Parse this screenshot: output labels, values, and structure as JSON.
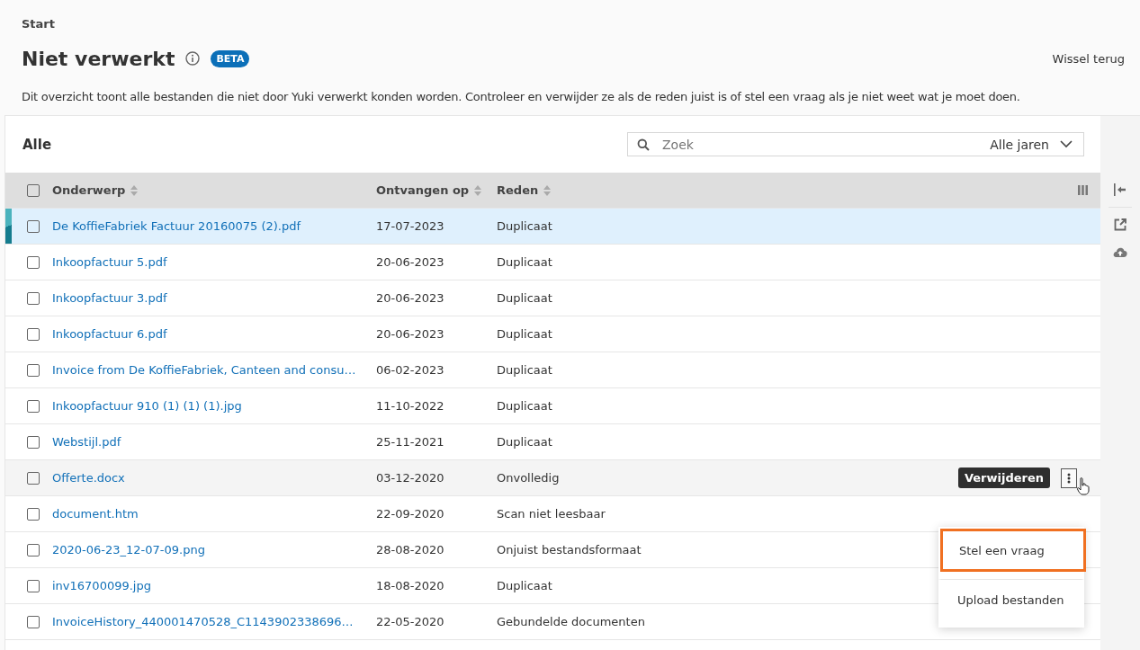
{
  "breadcrumb": "Start",
  "title": "Niet verwerkt",
  "badge": "BETA",
  "switch_back": "Wissel terug",
  "description": "Dit overzicht toont alle bestanden die niet door Yuki verwerkt konden worden. Controleer en verwijder ze als de reden juist is of stel een vraag als je niet weet wat je moet doen.",
  "panel": {
    "title": "Alle",
    "search": {
      "placeholder": "Zoek"
    },
    "year_filter": "Alle jaren"
  },
  "table": {
    "select_all_checked": false,
    "columns": [
      "Onderwerp",
      "Ontvangen op",
      "Reden"
    ],
    "rows": [
      {
        "subject": "De KoffieFabriek Factuur 20160075 (2).pdf",
        "received": "17-07-2023",
        "reason": "Duplicaat",
        "selected": true,
        "hovered": false,
        "checked": false
      },
      {
        "subject": "Inkoopfactuur 5.pdf",
        "received": "20-06-2023",
        "reason": "Duplicaat",
        "selected": false,
        "hovered": false,
        "checked": false
      },
      {
        "subject": "Inkoopfactuur 3.pdf",
        "received": "20-06-2023",
        "reason": "Duplicaat",
        "selected": false,
        "hovered": false,
        "checked": false
      },
      {
        "subject": "Inkoopfactuur 6.pdf",
        "received": "20-06-2023",
        "reason": "Duplicaat",
        "selected": false,
        "hovered": false,
        "checked": false
      },
      {
        "subject": "Invoice from De KoffieFabriek, Canteen and consu…",
        "received": "06-02-2023",
        "reason": "Duplicaat",
        "selected": false,
        "hovered": false,
        "checked": false
      },
      {
        "subject": "Inkoopfactuur 910 (1) (1) (1).jpg",
        "received": "11-10-2022",
        "reason": "Duplicaat",
        "selected": false,
        "hovered": false,
        "checked": false
      },
      {
        "subject": "Webstijl.pdf",
        "received": "25-11-2021",
        "reason": "Duplicaat",
        "selected": false,
        "hovered": false,
        "checked": false
      },
      {
        "subject": "Offerte.docx",
        "received": "03-12-2020",
        "reason": "Onvolledig",
        "selected": false,
        "hovered": true,
        "checked": false
      },
      {
        "subject": "document.htm",
        "received": "22-09-2020",
        "reason": "Scan niet leesbaar",
        "selected": false,
        "hovered": false,
        "checked": false
      },
      {
        "subject": "2020-06-23_12-07-09.png",
        "received": "28-08-2020",
        "reason": "Onjuist bestandsformaat",
        "selected": false,
        "hovered": false,
        "checked": false
      },
      {
        "subject": "inv16700099.jpg",
        "received": "18-08-2020",
        "reason": "Duplicaat",
        "selected": false,
        "hovered": false,
        "checked": false
      },
      {
        "subject": "InvoiceHistory_440001470528_C1143902338696…",
        "received": "22-05-2020",
        "reason": "Gebundelde documenten",
        "selected": false,
        "hovered": false,
        "checked": false
      }
    ]
  },
  "row_action": "Verwijderen",
  "menu": [
    {
      "label": "Stel een vraag",
      "highlighted": true
    },
    {
      "label": "Upload bestanden",
      "highlighted": false
    }
  ]
}
